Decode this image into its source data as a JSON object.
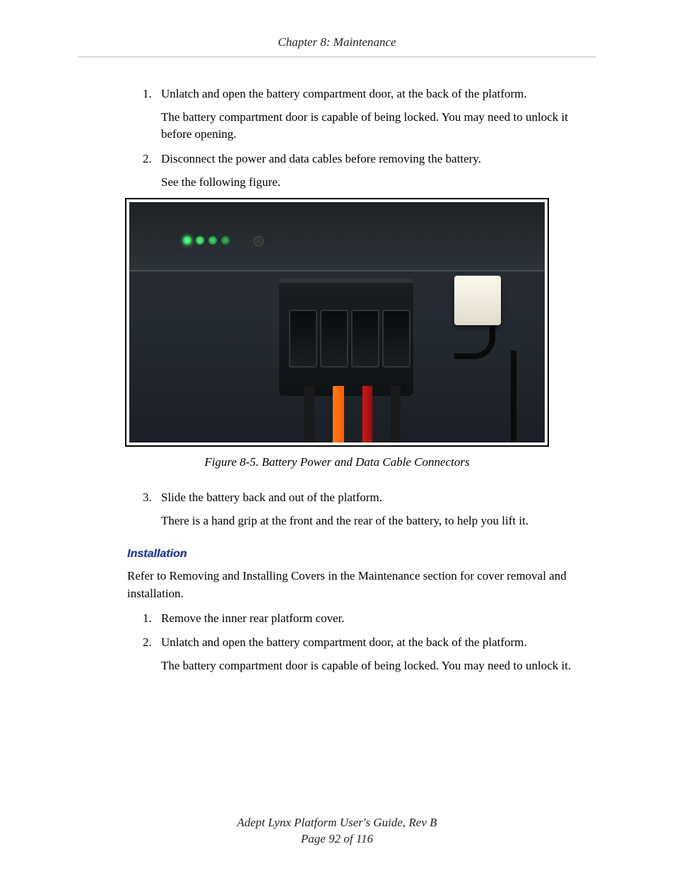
{
  "header": {
    "chapter": "Chapter 8: Maintenance"
  },
  "removal_steps": [
    {
      "num": "1.",
      "text": "Unlatch and open the battery compartment door, at the back of the platform.",
      "note": "The battery compartment door is capable of being locked. You may need to unlock it before opening."
    },
    {
      "num": "2.",
      "text": "Disconnect the power and data cables before removing the battery.",
      "note": "See the following figure."
    }
  ],
  "figure": {
    "caption": "Figure 8-5. Battery Power and Data Cable Connectors"
  },
  "removal_steps_after": [
    {
      "num": "3.",
      "text": "Slide the battery back and out of the platform.",
      "note": "There is a hand grip at the front and the rear of the battery, to help you lift it."
    }
  ],
  "installation": {
    "heading": "Installation",
    "intro": "Refer to Removing and Installing Covers in the Maintenance section for cover removal and installation.",
    "steps": [
      {
        "num": "1.",
        "text": "Remove the inner rear platform cover."
      },
      {
        "num": "2.",
        "text": "Unlatch and open the battery compartment door, at the back of the platform.",
        "note": "The battery compartment door is capable of being locked. You may need to unlock it."
      }
    ]
  },
  "footer": {
    "title": "Adept Lynx Platform User's Guide, Rev B",
    "page": "Page 92 of 116"
  }
}
